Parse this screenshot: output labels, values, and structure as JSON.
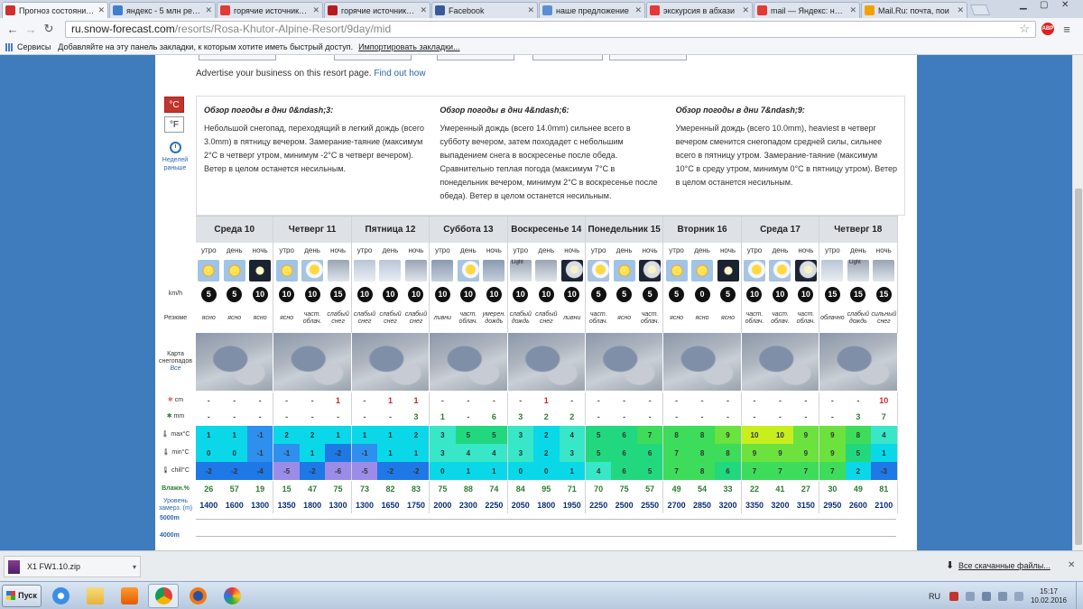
{
  "browser": {
    "tabs": [
      {
        "title": "Прогноз состояния с",
        "color": "#d32f2f",
        "active": true
      },
      {
        "title": "яндекс - 5 млн резул",
        "color": "#3f7fd0"
      },
      {
        "title": "горячие источники р",
        "color": "#e53935"
      },
      {
        "title": "горячие источники р",
        "color": "#b71c1c"
      },
      {
        "title": "Facebook",
        "color": "#3b5998"
      },
      {
        "title": "наше предложение",
        "color": "#5c8ed3"
      },
      {
        "title": "экскурсия в абхази",
        "color": "#e53935"
      },
      {
        "title": "mail — Яндекс: нашл",
        "color": "#e53935"
      },
      {
        "title": "Mail.Ru: почта, пои",
        "color": "#f4a100"
      }
    ],
    "url_host": "ru.snow-forecast.com",
    "url_path": "/resorts/Rosa-Khutor-Alpine-Resort/9day/mid",
    "abp_label": "ABP",
    "bookmarks": {
      "apps": "Сервисы",
      "hint": "Добавляйте на эту панель закладки, к которым хотите иметь быстрый доступ.",
      "import": "Импортировать закладки..."
    }
  },
  "page": {
    "advertise": "Advertise your business on this resort page.",
    "advertise_link": "Find out how",
    "units": {
      "celsius": "°C",
      "fahrenheit": "°F"
    },
    "prev": "Неделей раньше",
    "summaries": [
      {
        "title": "Обзор погоды в дни 0&ndash;3:",
        "text": "Небольшой снегопад, переходящий в легкий дождь (всего 3.0mm) в пятницу вечером. Замерание-таяние (максимум 2°C в четверг утром, минимум -2°C в четверг вечером). Ветер в целом останется несильным."
      },
      {
        "title": "Обзор погоды в дни 4&ndash;6:",
        "text": "Умеренный дождь (всего 14.0mm) сильнее всего в субботу вечером, затем походадет с небольшим выпадением снега в воскресенье после обеда. Сравнительно теплая погода (максимум 7°C в понедельник вечером, минимум 2°C в воскресенье после обеда). Ветер в целом останется несильным."
      },
      {
        "title": "Обзор погоды в дни 7&ndash;9:",
        "text": "Умеренный дождь (всего 10.0mm), heaviest в четверг вечером сменится снегопадом средней силы, сильнее всего в пятницу утром. Замерание-таяние (максимум 10°C в среду утром, минимум 0°C в пятницу утром). Ветер в целом останется несильным."
      }
    ],
    "labels": {
      "wind": "km/h",
      "summary": "Резюме",
      "map": "Карта снегопадов",
      "map_all": "Все",
      "snow": "cm",
      "rain": "mm",
      "max": "max°C",
      "min": "min°C",
      "chill": "chill°C",
      "hum": "Влажн.%",
      "frz": "Уровень замерз. (m)"
    },
    "altitudes": [
      "5000m",
      "4000m"
    ]
  },
  "forecast": {
    "days": [
      "Среда 10",
      "Четверг 11",
      "Пятница 12",
      "Суббота 13",
      "Воскресенье 14",
      "Понедельник 15",
      "Вторник 16",
      "Среда 17",
      "Четверг 18"
    ],
    "periods": [
      "утро",
      "день",
      "ночь"
    ],
    "icons": [
      [
        "sun",
        "sun",
        "night"
      ],
      [
        "sun",
        "pcloud",
        "snow"
      ],
      [
        "cloud",
        "cloud",
        "snow"
      ],
      [
        "rain",
        "pcloud",
        "rain"
      ],
      [
        "snow",
        "snow",
        "pnight"
      ],
      [
        "pcloud",
        "sun",
        "pnight"
      ],
      [
        "sun",
        "sun",
        "night"
      ],
      [
        "pcloud",
        "pcloud",
        "pnight"
      ],
      [
        "cloud",
        "snow",
        "snow"
      ]
    ],
    "icon_text": [
      [
        "",
        "",
        ""
      ],
      [
        "",
        "",
        ""
      ],
      [
        "",
        "",
        ""
      ],
      [
        "",
        "",
        ""
      ],
      [
        "Light",
        "",
        ""
      ],
      [
        "",
        "",
        ""
      ],
      [
        "",
        "",
        ""
      ],
      [
        "",
        "",
        ""
      ],
      [
        "",
        "Light",
        ""
      ]
    ],
    "wind": [
      [
        "5",
        "5",
        "10"
      ],
      [
        "10",
        "10",
        "15"
      ],
      [
        "10",
        "10",
        "10"
      ],
      [
        "10",
        "10",
        "10"
      ],
      [
        "10",
        "10",
        "10"
      ],
      [
        "5",
        "5",
        "5"
      ],
      [
        "5",
        "0",
        "5"
      ],
      [
        "10",
        "10",
        "10"
      ],
      [
        "15",
        "15",
        "15"
      ]
    ],
    "summary": [
      [
        "ясно",
        "ясно",
        "ясно"
      ],
      [
        "ясно",
        "част. облач.",
        "слабый снег"
      ],
      [
        "слабый снег",
        "слабый снег",
        "слабый снег"
      ],
      [
        "ливни",
        "част. облач.",
        "умерен. дождь"
      ],
      [
        "слабый дождь",
        "слабый снег",
        "ливни"
      ],
      [
        "част. облач.",
        "ясно",
        "част. облач."
      ],
      [
        "ясно",
        "ясно",
        "ясно"
      ],
      [
        "част. облач.",
        "част. облач.",
        "част. облач."
      ],
      [
        "облачно",
        "слабый дождь",
        "сильный снег"
      ]
    ],
    "snow": [
      [
        "-",
        "-",
        "-"
      ],
      [
        "-",
        "-",
        "1"
      ],
      [
        "-",
        "1",
        "1"
      ],
      [
        "-",
        "-",
        "-"
      ],
      [
        "-",
        "1",
        "-"
      ],
      [
        "-",
        "-",
        "-"
      ],
      [
        "-",
        "-",
        "-"
      ],
      [
        "-",
        "-",
        "-"
      ],
      [
        "-",
        "-",
        "10"
      ]
    ],
    "rain": [
      [
        "-",
        "-",
        "-"
      ],
      [
        "-",
        "-",
        "-"
      ],
      [
        "-",
        "-",
        "3"
      ],
      [
        "1",
        "-",
        "6"
      ],
      [
        "3",
        "2",
        "2"
      ],
      [
        "-",
        "-",
        "-"
      ],
      [
        "-",
        "-",
        "-"
      ],
      [
        "-",
        "-",
        "-"
      ],
      [
        "-",
        "3",
        "7"
      ]
    ],
    "tmax": [
      [
        "1",
        "1",
        "-1"
      ],
      [
        "2",
        "2",
        "1"
      ],
      [
        "1",
        "1",
        "2"
      ],
      [
        "3",
        "5",
        "5"
      ],
      [
        "3",
        "2",
        "4"
      ],
      [
        "5",
        "6",
        "7"
      ],
      [
        "8",
        "8",
        "9"
      ],
      [
        "10",
        "10",
        "9"
      ],
      [
        "9",
        "8",
        "4"
      ]
    ],
    "tmin": [
      [
        "0",
        "0",
        "-1"
      ],
      [
        "-1",
        "1",
        "-2"
      ],
      [
        "-1",
        "1",
        "1"
      ],
      [
        "3",
        "4",
        "4"
      ],
      [
        "3",
        "2",
        "3"
      ],
      [
        "5",
        "6",
        "6"
      ],
      [
        "7",
        "8",
        "8"
      ],
      [
        "9",
        "9",
        "9"
      ],
      [
        "9",
        "5",
        "1"
      ]
    ],
    "tchill": [
      [
        "-2",
        "-2",
        "-4"
      ],
      [
        "-5",
        "-2",
        "-6"
      ],
      [
        "-5",
        "-2",
        "-2"
      ],
      [
        "0",
        "1",
        "1"
      ],
      [
        "0",
        "0",
        "1"
      ],
      [
        "4",
        "6",
        "5"
      ],
      [
        "7",
        "8",
        "6"
      ],
      [
        "7",
        "7",
        "7"
      ],
      [
        "7",
        "2",
        "-3"
      ]
    ],
    "humidity": [
      [
        "26",
        "57",
        "19"
      ],
      [
        "15",
        "47",
        "75"
      ],
      [
        "73",
        "82",
        "83"
      ],
      [
        "75",
        "88",
        "74"
      ],
      [
        "84",
        "95",
        "71"
      ],
      [
        "70",
        "75",
        "57"
      ],
      [
        "49",
        "54",
        "33"
      ],
      [
        "22",
        "41",
        "27"
      ],
      [
        "30",
        "49",
        "81"
      ]
    ],
    "freezing": [
      [
        "1400",
        "1600",
        "1300"
      ],
      [
        "1350",
        "1800",
        "1300"
      ],
      [
        "1300",
        "1650",
        "1750"
      ],
      [
        "2000",
        "2300",
        "2250"
      ],
      [
        "2050",
        "1800",
        "1950"
      ],
      [
        "2250",
        "2500",
        "2550"
      ],
      [
        "2700",
        "2850",
        "3200"
      ],
      [
        "3350",
        "3200",
        "3150"
      ],
      [
        "2950",
        "2600",
        "2100"
      ]
    ]
  },
  "downloads": {
    "file": "X1 FW1.10.zip",
    "all": "Все скачанные файлы..."
  },
  "taskbar": {
    "start": "Пуск",
    "lang": "RU",
    "time": "15:17",
    "date": "10.02.2016"
  },
  "colors": {
    "page_bg": "#3e7cbd",
    "accent_red": "#c0352c",
    "link": "#2866b1"
  }
}
